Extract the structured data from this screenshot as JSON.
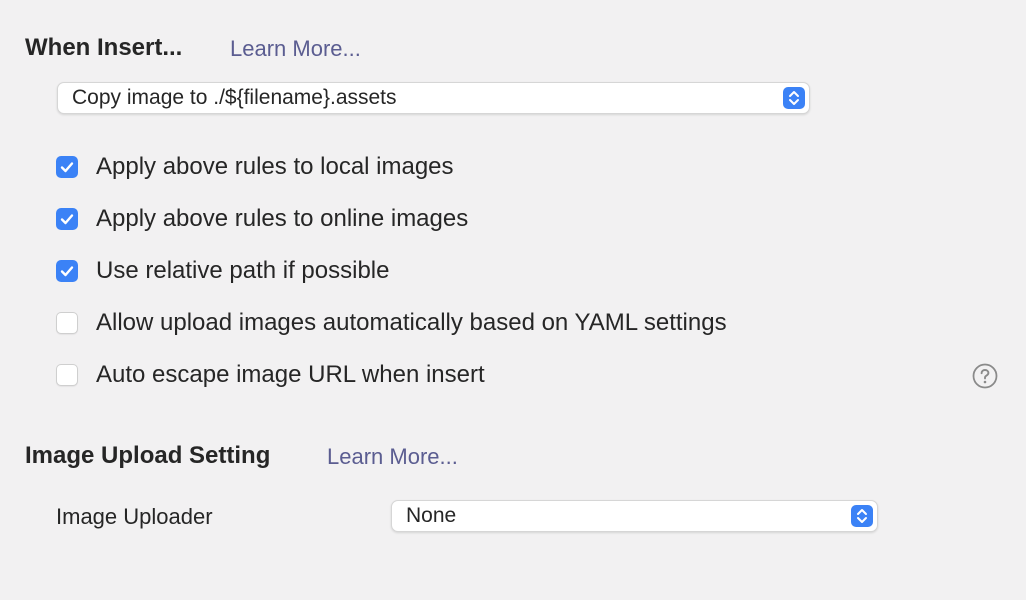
{
  "when_insert": {
    "title": "When Insert...",
    "learn_more": "Learn More...",
    "action_select": {
      "value": "Copy image to ./${filename}.assets"
    },
    "options": [
      {
        "label": "Apply above rules to local images",
        "checked": true
      },
      {
        "label": "Apply above rules to online images",
        "checked": true
      },
      {
        "label": "Use relative path if possible",
        "checked": true
      },
      {
        "label": "Allow upload images automatically based on YAML settings",
        "checked": false
      },
      {
        "label": "Auto escape image URL when insert",
        "checked": false
      }
    ],
    "help_icon": "question-circle-icon"
  },
  "image_upload": {
    "title": "Image Upload Setting",
    "learn_more": "Learn More...",
    "uploader_label": "Image Uploader",
    "uploader_select": {
      "value": "None"
    }
  },
  "colors": {
    "accent": "#3b82f6",
    "link": "#5b5d91",
    "background": "#f2f1f2"
  }
}
